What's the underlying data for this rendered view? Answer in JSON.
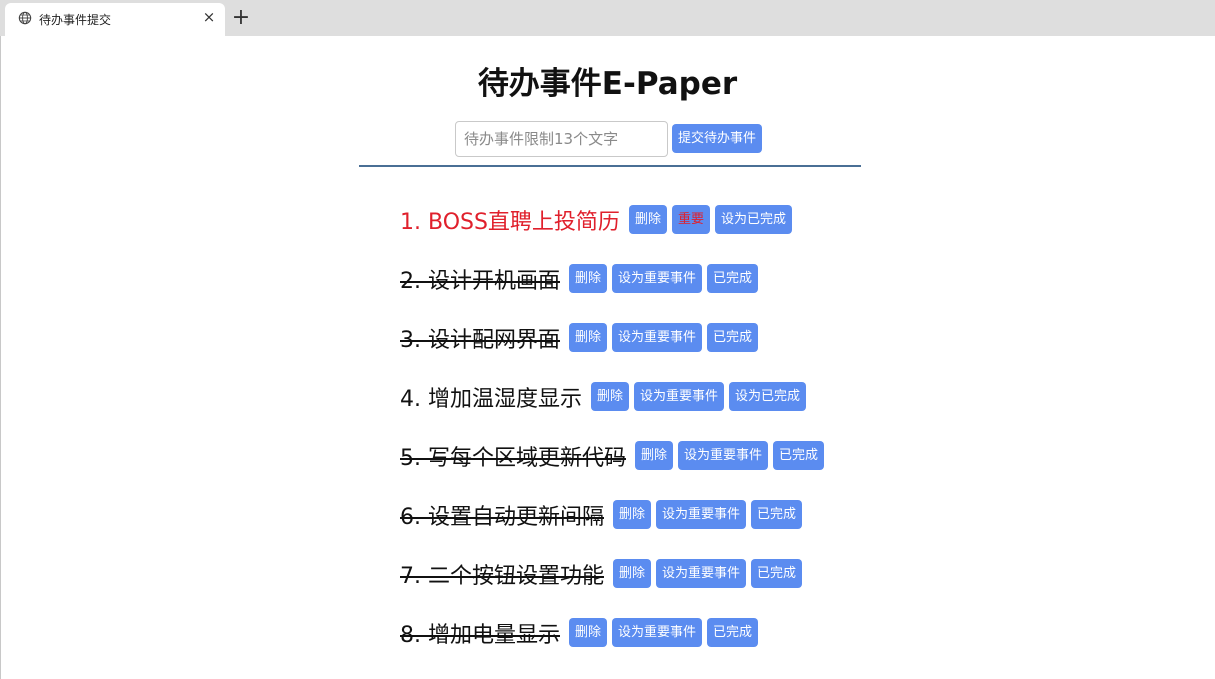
{
  "browser": {
    "tab_title": "待办事件提交",
    "close_glyph": "×",
    "new_tab_glyph": "+"
  },
  "page": {
    "title": "待办事件E-Paper",
    "input_placeholder": "待办事件限制13个文字",
    "input_value": "",
    "submit_label": "提交待办事件"
  },
  "todos": [
    {
      "text": "1. BOSS直聘上投简历",
      "delete_label": "删除",
      "importance_label": "重要",
      "status_label": "设为已完成",
      "done": false,
      "important": true
    },
    {
      "text": "2. 设计开机画面",
      "delete_label": "删除",
      "importance_label": "设为重要事件",
      "status_label": "已完成",
      "done": true,
      "important": false
    },
    {
      "text": "3. 设计配网界面",
      "delete_label": "删除",
      "importance_label": "设为重要事件",
      "status_label": "已完成",
      "done": true,
      "important": false
    },
    {
      "text": "4. 增加温湿度显示",
      "delete_label": "删除",
      "importance_label": "设为重要事件",
      "status_label": "设为已完成",
      "done": false,
      "important": false
    },
    {
      "text": "5. 写每个区域更新代码",
      "delete_label": "删除",
      "importance_label": "设为重要事件",
      "status_label": "已完成",
      "done": true,
      "important": false
    },
    {
      "text": "6. 设置自动更新间隔",
      "delete_label": "删除",
      "importance_label": "设为重要事件",
      "status_label": "已完成",
      "done": true,
      "important": false
    },
    {
      "text": "7. 二个按钮设置功能",
      "delete_label": "删除",
      "importance_label": "设为重要事件",
      "status_label": "已完成",
      "done": true,
      "important": false
    },
    {
      "text": "8. 增加电量显示",
      "delete_label": "删除",
      "importance_label": "设为重要事件",
      "status_label": "已完成",
      "done": true,
      "important": false
    }
  ],
  "colors": {
    "button_bg": "#5b8cf0",
    "important_text": "#e0202c",
    "divider": "#4a6f95"
  }
}
